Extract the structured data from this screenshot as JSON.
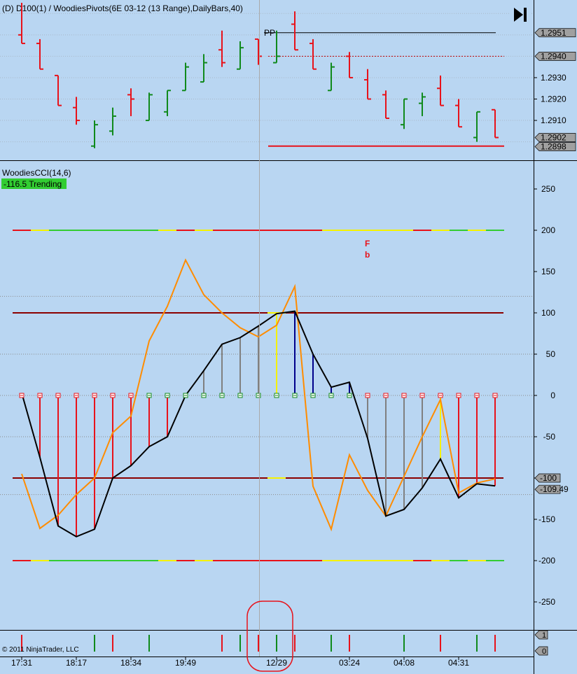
{
  "header": {
    "title": "(D) D100(1) / WoodiesPivots(6E 03-12 (13 Range),DailyBars,40)",
    "pp_label": "PP"
  },
  "price_panel": {
    "ylim": [
      1.2893,
      1.2965
    ],
    "ticks": [
      "1.2930",
      "1.2920",
      "1.2910"
    ],
    "badges": [
      {
        "label": "1.2951",
        "value": 1.2951
      },
      {
        "label": "1.2940",
        "value": 1.294
      },
      {
        "label": "1.2902",
        "value": 1.2902
      },
      {
        "label": "1.2898",
        "value": 1.2898
      }
    ],
    "pp_level": 1.2951,
    "dashed_level": 1.294,
    "support_level": 1.2898,
    "bars": [
      {
        "high": 1.2965,
        "low": 1.2946,
        "open": 1.295,
        "close": 1.2946,
        "color": "#e8121a"
      },
      {
        "high": 1.2948,
        "low": 1.2934,
        "open": 1.2946,
        "close": 1.2934,
        "color": "#e8121a"
      },
      {
        "high": 1.2931,
        "low": 1.2917,
        "open": 1.2931,
        "close": 1.2917,
        "color": "#e8121a"
      },
      {
        "high": 1.2921,
        "low": 1.2908,
        "open": 1.2916,
        "close": 1.291,
        "color": "#e8121a"
      },
      {
        "high": 1.291,
        "low": 1.2897,
        "open": 1.2898,
        "close": 1.2908,
        "color": "#108a1c"
      },
      {
        "high": 1.2916,
        "low": 1.2903,
        "open": 1.2905,
        "close": 1.2912,
        "color": "#108a1c"
      },
      {
        "high": 1.2925,
        "low": 1.2912,
        "open": 1.2922,
        "close": 1.292,
        "color": "#e8121a"
      },
      {
        "high": 1.2923,
        "low": 1.291,
        "open": 1.291,
        "close": 1.2922,
        "color": "#108a1c"
      },
      {
        "high": 1.2924,
        "low": 1.2912,
        "open": 1.2914,
        "close": 1.2924,
        "color": "#108a1c"
      },
      {
        "high": 1.2937,
        "low": 1.2924,
        "open": 1.2924,
        "close": 1.2935,
        "color": "#108a1c"
      },
      {
        "high": 1.2941,
        "low": 1.2928,
        "open": 1.2928,
        "close": 1.2937,
        "color": "#108a1c"
      },
      {
        "high": 1.2952,
        "low": 1.2935,
        "open": 1.2943,
        "close": 1.2937,
        "color": "#e8121a"
      },
      {
        "high": 1.2947,
        "low": 1.2934,
        "open": 1.2934,
        "close": 1.2944,
        "color": "#108a1c"
      },
      {
        "high": 1.2948,
        "low": 1.2936,
        "open": 1.2948,
        "close": 1.294,
        "color": "#e8121a"
      },
      {
        "high": 1.2952,
        "low": 1.2937,
        "open": 1.2937,
        "close": 1.294,
        "color": "#108a1c"
      },
      {
        "high": 1.2961,
        "low": 1.2943,
        "open": 1.2955,
        "close": 1.2943,
        "color": "#e8121a"
      },
      {
        "high": 1.2948,
        "low": 1.2934,
        "open": 1.2946,
        "close": 1.2934,
        "color": "#e8121a"
      },
      {
        "high": 1.2937,
        "low": 1.2924,
        "open": 1.2924,
        "close": 1.2935,
        "color": "#108a1c"
      },
      {
        "high": 1.2942,
        "low": 1.293,
        "open": 1.294,
        "close": 1.293,
        "color": "#e8121a"
      },
      {
        "high": 1.2934,
        "low": 1.292,
        "open": 1.2929,
        "close": 1.292,
        "color": "#e8121a"
      },
      {
        "high": 1.2924,
        "low": 1.2911,
        "open": 1.2922,
        "close": 1.2911,
        "color": "#e8121a"
      },
      {
        "high": 1.292,
        "low": 1.2906,
        "open": 1.2908,
        "close": 1.292,
        "color": "#108a1c"
      },
      {
        "high": 1.2923,
        "low": 1.2912,
        "open": 1.2918,
        "close": 1.2921,
        "color": "#108a1c"
      },
      {
        "high": 1.2931,
        "low": 1.2917,
        "open": 1.2925,
        "close": 1.2917,
        "color": "#e8121a"
      },
      {
        "high": 1.292,
        "low": 1.2907,
        "open": 1.2917,
        "close": 1.2907,
        "color": "#e8121a"
      },
      {
        "high": 1.2914,
        "low": 1.29,
        "open": 1.2902,
        "close": 1.2914,
        "color": "#108a1c"
      },
      {
        "high": 1.2915,
        "low": 1.2902,
        "open": 1.2915,
        "close": 1.2902,
        "color": "#e8121a"
      }
    ]
  },
  "cci_panel": {
    "label": "WoodiesCCI(14,6)",
    "status_badge": "-116.5 Trending",
    "ylim": [
      -280,
      280
    ],
    "ticks": [
      "250",
      "200",
      "150",
      "100",
      "50",
      "0",
      "-50",
      "-100",
      "-150",
      "-200",
      "-250"
    ],
    "tick_values": [
      250,
      200,
      150,
      100,
      50,
      0,
      -50,
      -100,
      -150,
      -200,
      -250
    ],
    "value_badges": [
      {
        "label": "-100",
        "value": -100
      },
      {
        "label": "-109.49",
        "value": -109.49
      }
    ],
    "markers": [
      "F",
      "b"
    ],
    "cci_line": [
      3,
      -75,
      -158,
      -171,
      -162,
      -100,
      -85,
      -62,
      -50,
      0,
      30,
      62,
      70,
      84,
      99,
      102,
      50,
      10,
      16,
      -52,
      -146,
      -138,
      -112,
      -77,
      -124,
      -107,
      -109.49
    ],
    "tcci_line": [
      -95,
      -161,
      -145,
      -120,
      -100,
      -45,
      -25,
      66,
      108,
      164,
      122,
      100,
      82,
      71,
      85,
      132,
      -110,
      -162,
      -72,
      -115,
      -146,
      -98,
      -50,
      -5,
      -118,
      -106,
      -101
    ],
    "histogram": [
      {
        "value": 0,
        "color": "#e8121a"
      },
      {
        "value": -75,
        "color": "#e8121a"
      },
      {
        "value": -158,
        "color": "#e8121a"
      },
      {
        "value": -171,
        "color": "#e8121a"
      },
      {
        "value": -162,
        "color": "#e8121a"
      },
      {
        "value": -100,
        "color": "#e8121a"
      },
      {
        "value": -85,
        "color": "#e8121a"
      },
      {
        "value": -62,
        "color": "#e8121a"
      },
      {
        "value": -50,
        "color": "#e8121a"
      },
      {
        "value": 0,
        "color": "#e8121a"
      },
      {
        "value": 30,
        "color": "#808080"
      },
      {
        "value": 62,
        "color": "#808080"
      },
      {
        "value": 70,
        "color": "#808080"
      },
      {
        "value": 84,
        "color": "#808080"
      },
      {
        "value": 99,
        "color": "#f5f200"
      },
      {
        "value": 102,
        "color": "#00008b"
      },
      {
        "value": 50,
        "color": "#00008b"
      },
      {
        "value": 10,
        "color": "#00008b"
      },
      {
        "value": 16,
        "color": "#00008b"
      },
      {
        "value": -52,
        "color": "#808080"
      },
      {
        "value": -146,
        "color": "#808080"
      },
      {
        "value": -138,
        "color": "#808080"
      },
      {
        "value": -112,
        "color": "#808080"
      },
      {
        "value": -77,
        "color": "#f5f200"
      },
      {
        "value": -124,
        "color": "#e8121a"
      },
      {
        "value": -107,
        "color": "#e8121a"
      },
      {
        "value": -109.49,
        "color": "#e8121a"
      }
    ],
    "zero_markers": [
      "#e8121a",
      "#e8121a",
      "#e8121a",
      "#e8121a",
      "#e8121a",
      "#e8121a",
      "#e8121a",
      "#108a1c",
      "#108a1c",
      "#108a1c",
      "#108a1c",
      "#108a1c",
      "#108a1c",
      "#108a1c",
      "#108a1c",
      "#108a1c",
      "#108a1c",
      "#108a1c",
      "#108a1c",
      "#e8121a",
      "#e8121a",
      "#e8121a",
      "#e8121a",
      "#e8121a",
      "#e8121a",
      "#e8121a",
      "#e8121a"
    ],
    "band_colors": [
      "#e8121a",
      "#f5f200",
      "#33cc33",
      "#33cc33",
      "#33cc33",
      "#33cc33",
      "#33cc33",
      "#33cc33",
      "#f5f200",
      "#e8121a",
      "#f5f200",
      "#e8121a",
      "#e8121a",
      "#e8121a",
      "#e8121a",
      "#e8121a",
      "#e8121a",
      "#f5f200",
      "#f5f200",
      "#f5f200",
      "#f5f200",
      "#f5f200",
      "#e8121a",
      "#f5f200",
      "#33cc33",
      "#f5f200",
      "#33cc33"
    ],
    "gray_dotted_levels": [
      -120,
      -50,
      50,
      120
    ],
    "dark_red_levels": [
      100,
      -100
    ],
    "band_levels": [
      200,
      -200
    ]
  },
  "volume_panel": {
    "labels": [
      "1",
      "0"
    ],
    "copyright": "© 2011 NinjaTrader, LLC",
    "bars": [
      "#e8121a",
      "",
      "",
      "",
      "#108a1c",
      "#e8121a",
      "",
      "#108a1c",
      "",
      "",
      "",
      "#e8121a",
      "#108a1c",
      "#e8121a",
      "#108a1c",
      "#e8121a",
      "",
      "#108a1c",
      "#e8121a",
      "",
      "",
      "#108a1c",
      "",
      "#e8121a",
      "",
      "#108a1c",
      "#e8121a"
    ]
  },
  "time_axis": {
    "labels": [
      "17:31",
      "18:17",
      "18:34",
      "19:49",
      "12/29",
      "03:24",
      "04:08",
      "04:31"
    ],
    "label_bars": [
      0,
      3,
      6,
      9,
      14,
      18,
      21,
      24
    ]
  },
  "colors": {
    "background": "#b9d6f2",
    "up_bar": "#108a1c",
    "down_bar": "#e8121a",
    "cci_line": "#000000",
    "tcci_line": "#ff8c00",
    "level_line": "#8b0000",
    "highlight_circle": "#e8121a"
  }
}
